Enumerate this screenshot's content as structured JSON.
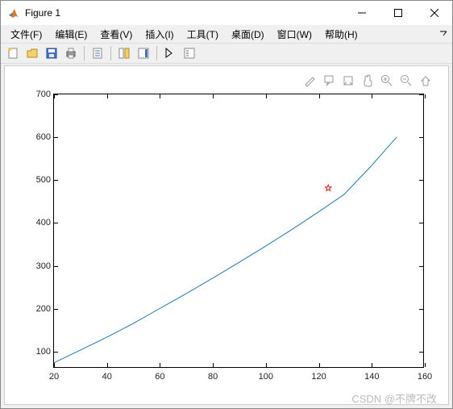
{
  "window": {
    "title": "Figure 1"
  },
  "menu": {
    "file": "文件(F)",
    "edit": "编辑(E)",
    "view": "查看(V)",
    "insert": "插入(I)",
    "tools": "工具(T)",
    "desktop": "桌面(D)",
    "window": "窗口(W)",
    "help": "帮助(H)"
  },
  "watermark": "CSDN @不牌不改",
  "chart_data": {
    "type": "line",
    "x": [
      20,
      30,
      40,
      50,
      60,
      70,
      80,
      90,
      100,
      110,
      120,
      130,
      140,
      150
    ],
    "y": [
      70,
      100,
      130,
      162,
      197,
      232,
      268,
      305,
      343,
      382,
      423,
      465,
      530,
      600
    ],
    "marker": {
      "x": 124,
      "y": 480,
      "shape": "star",
      "color": "#d62728"
    },
    "xticks": [
      20,
      40,
      60,
      80,
      100,
      120,
      140,
      160
    ],
    "yticks": [
      100,
      200,
      300,
      400,
      500,
      600,
      700
    ],
    "xlim": [
      20,
      160
    ],
    "ylim": [
      60,
      700
    ],
    "line_color": "#1f77b4",
    "title": "",
    "xlabel": "",
    "ylabel": ""
  }
}
